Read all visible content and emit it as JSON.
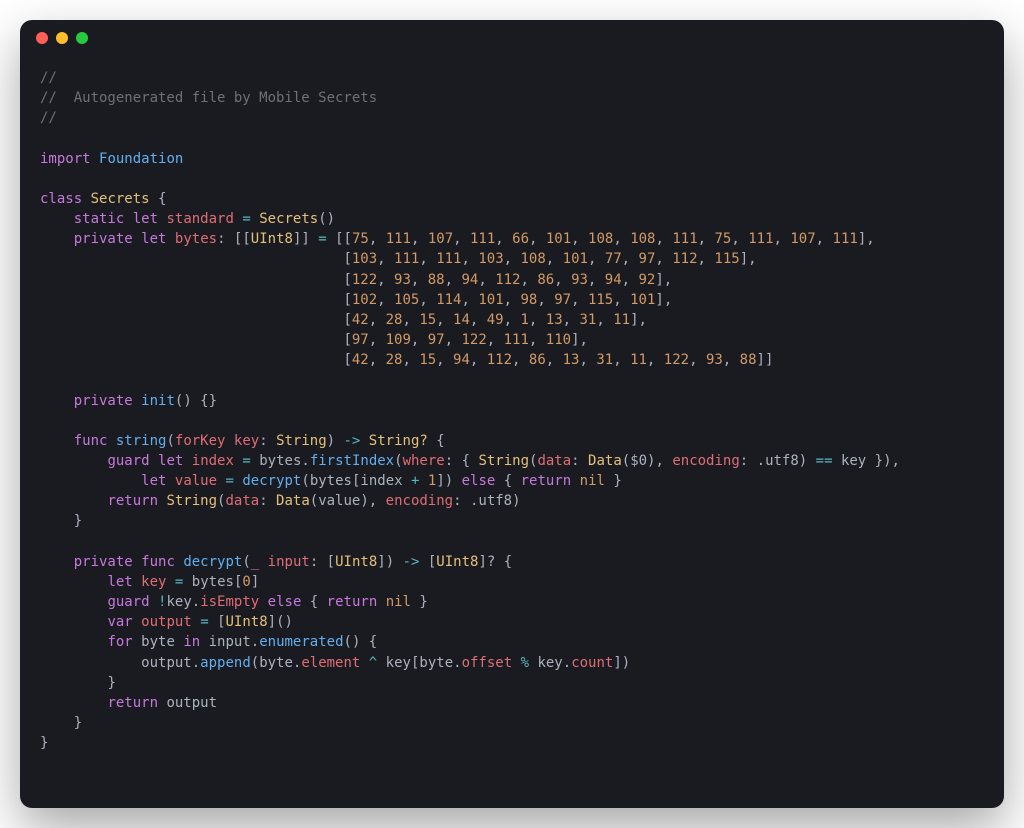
{
  "comment_line1": "//",
  "comment_line2": "//  Autogenerated file by Mobile Secrets",
  "comment_line3": "//",
  "kw_import": "import",
  "mod_Foundation": "Foundation",
  "kw_class": "class",
  "cls_Secrets": "Secrets",
  "kw_static": "static",
  "kw_let": "let",
  "kw_var": "var",
  "kw_private": "private",
  "kw_func": "func",
  "kw_guard": "guard",
  "kw_else": "else",
  "kw_return": "return",
  "kw_for": "for",
  "kw_in": "in",
  "kw_nil": "nil",
  "id_standard": "standard",
  "id_bytes": "bytes",
  "id_init": "init",
  "id_string": "string",
  "id_forKey": "forKey",
  "id_key": "key",
  "id_index": "index",
  "id_value": "value",
  "id_decrypt": "decrypt",
  "id_input": "input",
  "id_output": "output",
  "id_byte": "byte",
  "id_firstIndex": "firstIndex",
  "id_where": "where",
  "id_data": "data",
  "id_encoding": "encoding",
  "id_utf8": "utf8",
  "id_isEmpty": "isEmpty",
  "id_enumerated": "enumerated",
  "id_append": "append",
  "id_element": "element",
  "id_offset": "offset",
  "id_count": "count",
  "type_String": "String",
  "type_StringOpt": "String?",
  "type_UInt8": "UInt8",
  "type_Data": "Data",
  "bytes_values": {
    "row0": [
      "75",
      "111",
      "107",
      "111",
      "66",
      "101",
      "108",
      "108",
      "111",
      "75",
      "111",
      "107",
      "111"
    ],
    "row1": [
      "103",
      "111",
      "111",
      "103",
      "108",
      "101",
      "77",
      "97",
      "112",
      "115"
    ],
    "row2": [
      "122",
      "93",
      "88",
      "94",
      "112",
      "86",
      "93",
      "94",
      "92"
    ],
    "row3": [
      "102",
      "105",
      "114",
      "101",
      "98",
      "97",
      "115",
      "101"
    ],
    "row4": [
      "42",
      "28",
      "15",
      "14",
      "49",
      "1",
      "13",
      "31",
      "11"
    ],
    "row5": [
      "97",
      "109",
      "97",
      "122",
      "111",
      "110"
    ],
    "row6": [
      "42",
      "28",
      "15",
      "94",
      "112",
      "86",
      "13",
      "31",
      "11",
      "122",
      "93",
      "88"
    ]
  },
  "num_0": "0",
  "num_1": "1",
  "dollar0": "$0"
}
